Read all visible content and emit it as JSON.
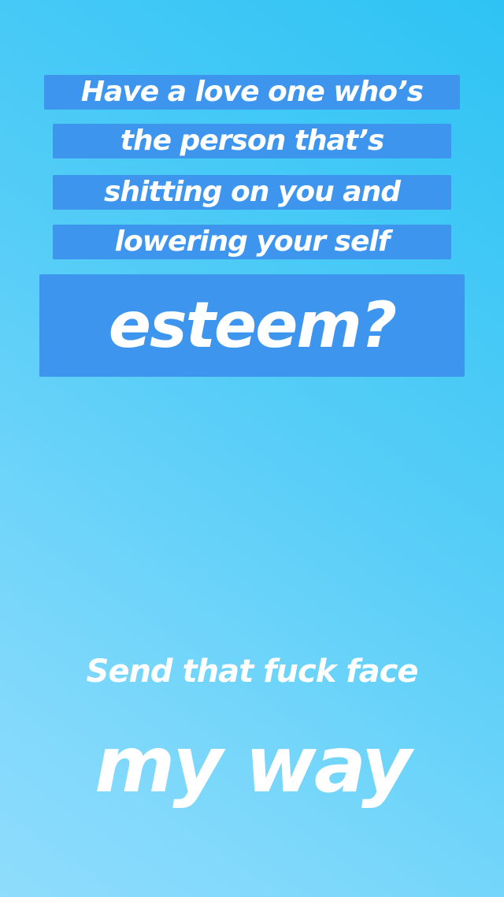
{
  "story": {
    "highlighted_text": {
      "lines": [
        "Have a love one who’s",
        "the person that’s",
        "shitting on you and",
        "lowering your self"
      ],
      "emphasis": "esteem?"
    },
    "plain_text": {
      "line1": "Send that fuck face",
      "line2": "my way"
    },
    "colors": {
      "highlight": "#3d95ee",
      "text": "#ffffff",
      "gradient_top": "#2ec3f4",
      "gradient_bottom": "#8fdcfc"
    }
  }
}
